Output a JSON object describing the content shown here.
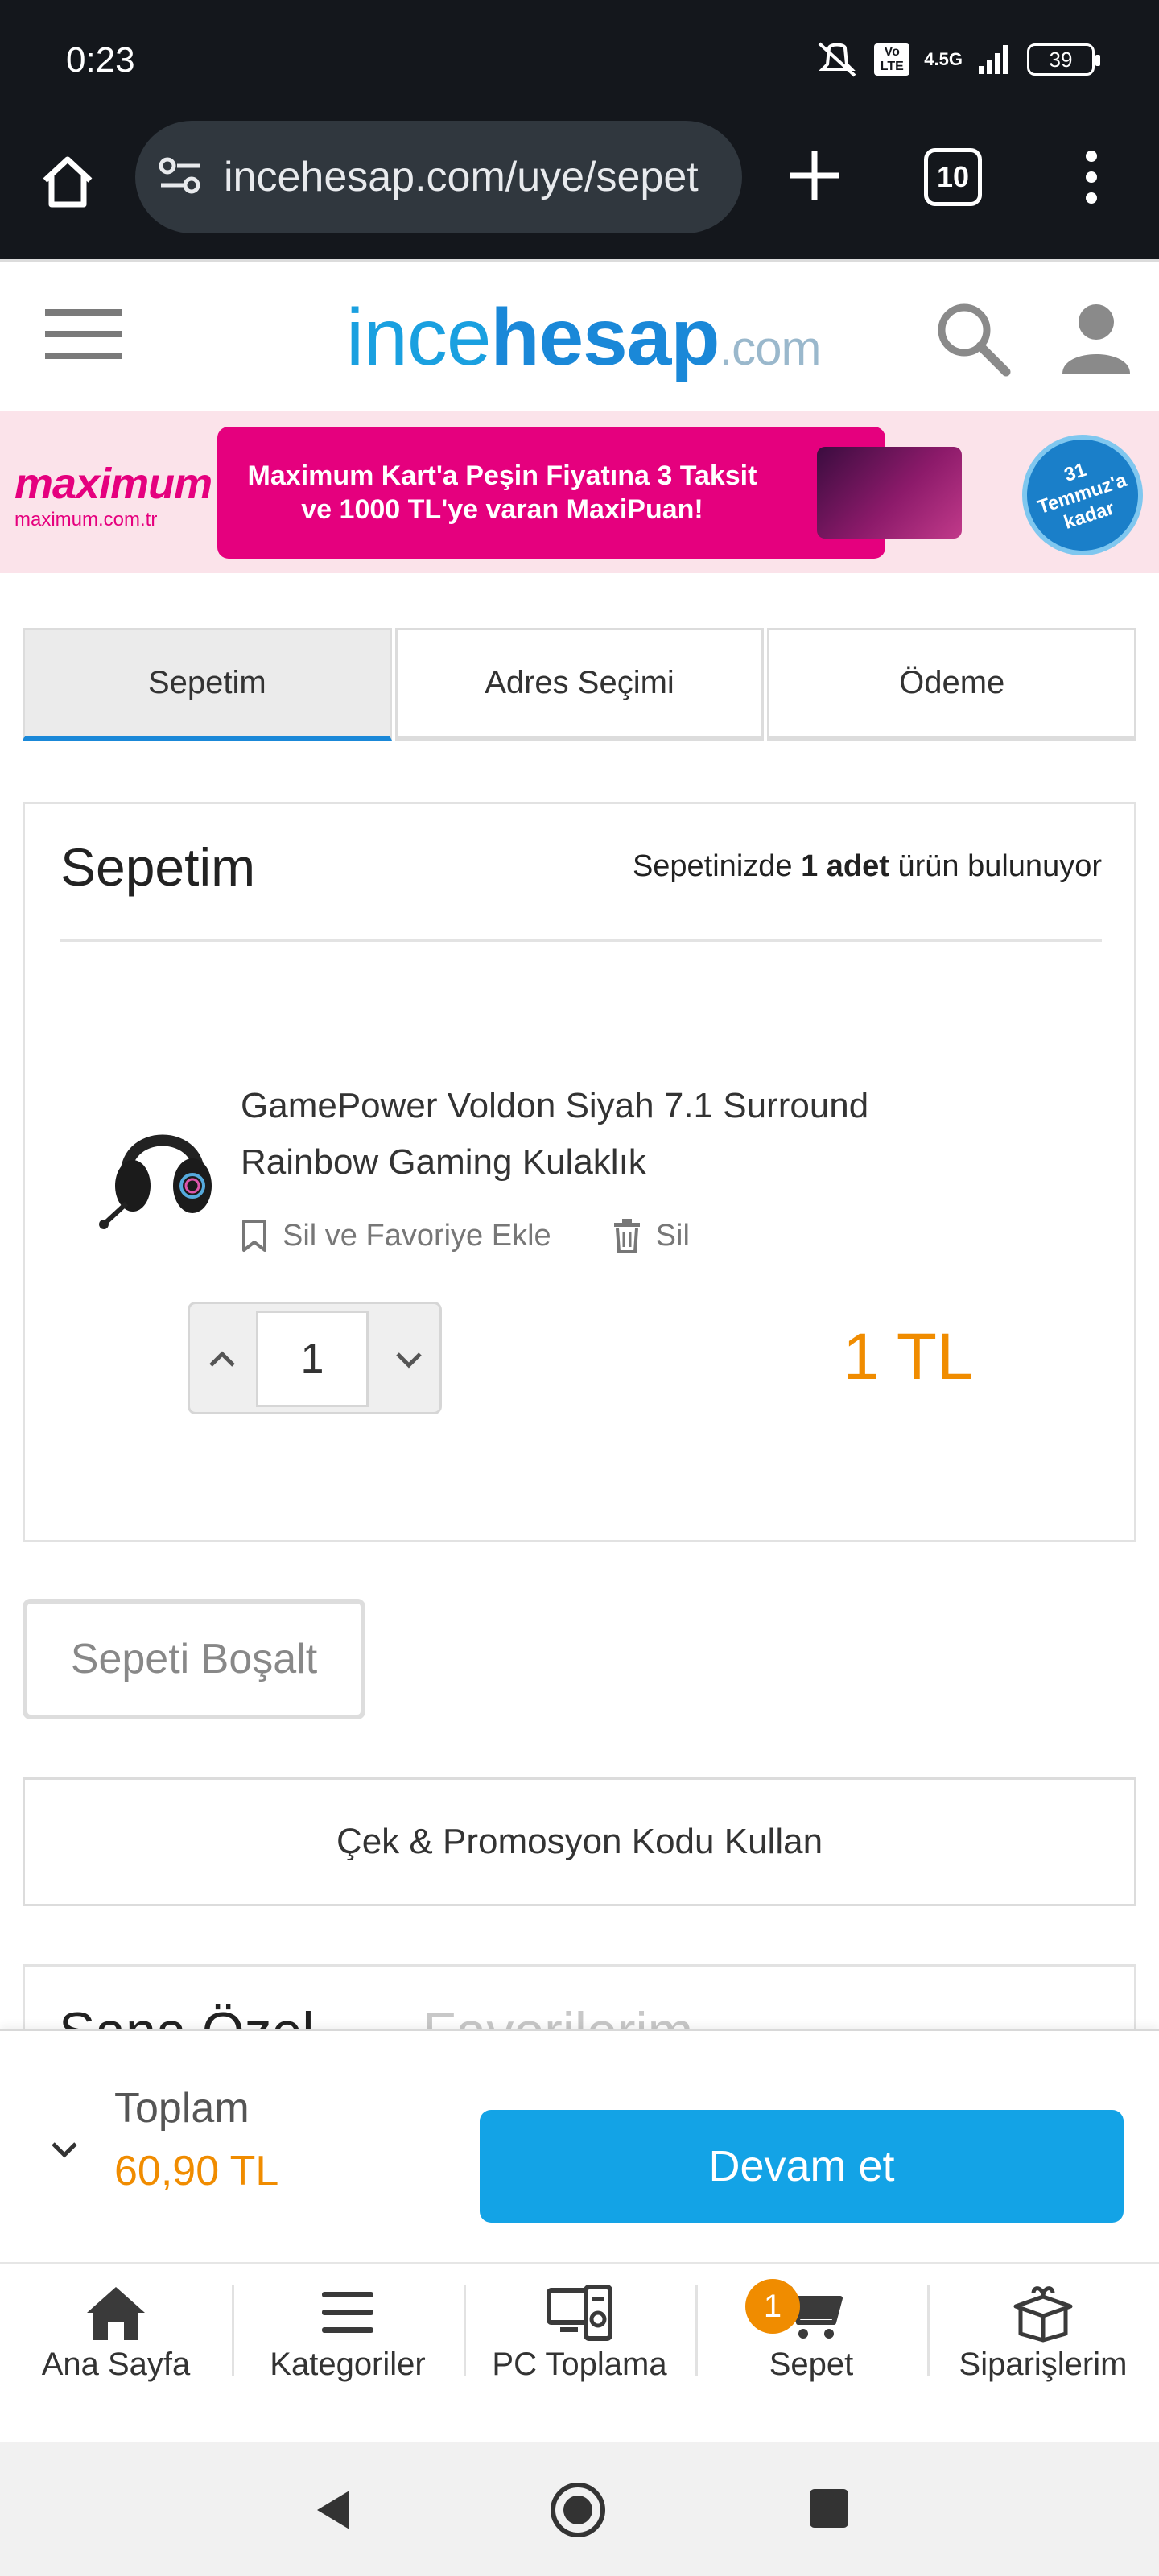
{
  "status": {
    "time": "0:23",
    "network": "4.5G",
    "volte": "Vo LTE",
    "battery": "39"
  },
  "browser": {
    "url": "incehesap.com/uye/sepet",
    "tab_count": "10"
  },
  "header": {
    "logo_ince": "ince",
    "logo_hesap": "hesap",
    "logo_com": ".com"
  },
  "banner": {
    "brand": "maximum",
    "brand_url": "maximum.com.tr",
    "line1": "Maximum Kart'a Peşin Fiyatına 3 Taksit",
    "line2": "ve 1000 TL'ye varan MaxiPuan!",
    "badge_line1": "31",
    "badge_line2": "Temmuz'a",
    "badge_line3": "kadar"
  },
  "steps": [
    {
      "label": "Sepetim",
      "active": true
    },
    {
      "label": "Adres Seçimi",
      "active": false
    },
    {
      "label": "Ödeme",
      "active": false
    }
  ],
  "cart": {
    "title": "Sepetim",
    "count_prefix": "Sepetinizde ",
    "count_value": "1 adet",
    "count_suffix": " ürün bulunuyor",
    "item": {
      "name_line1": "GamePower Voldon Siyah 7.1 Surround",
      "name_line2": "Rainbow Gaming Kulaklık",
      "save_label": "Sil ve Favoriye Ekle",
      "delete_label": "Sil",
      "quantity": "1",
      "price": "1 TL"
    },
    "empty_label": "Sepeti Boşalt",
    "promo_label": "Çek & Promosyon Kodu Kullan"
  },
  "special": {
    "tab1": "Sana Özel",
    "tab2": "Favorilerim"
  },
  "total": {
    "label": "Toplam",
    "value": "60,90 TL",
    "continue_label": "Devam et"
  },
  "bottom_nav": {
    "home": "Ana Sayfa",
    "categories": "Kategoriler",
    "pc_build": "PC Toplama",
    "cart": "Sepet",
    "cart_badge": "1",
    "orders": "Siparişlerim"
  },
  "colors": {
    "accent_blue": "#13a3e6",
    "price_orange": "#f08c00",
    "banner_pink": "#e5007e"
  }
}
